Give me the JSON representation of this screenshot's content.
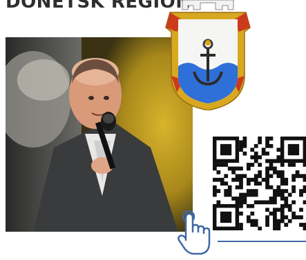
{
  "header": {
    "title": "DONETSK REGION"
  },
  "colors": {
    "accent_blue": "#3f68a5",
    "coat_gold": "#d7a820",
    "coat_red": "#cc3a1c",
    "coat_sky": "#2f6fd8",
    "photo_yellow": "#c9a322"
  },
  "icons": {
    "coat_of_arms": "city-coat-of-arms-icon",
    "qr": "qr-code",
    "hand": "hand-pointer-icon"
  }
}
